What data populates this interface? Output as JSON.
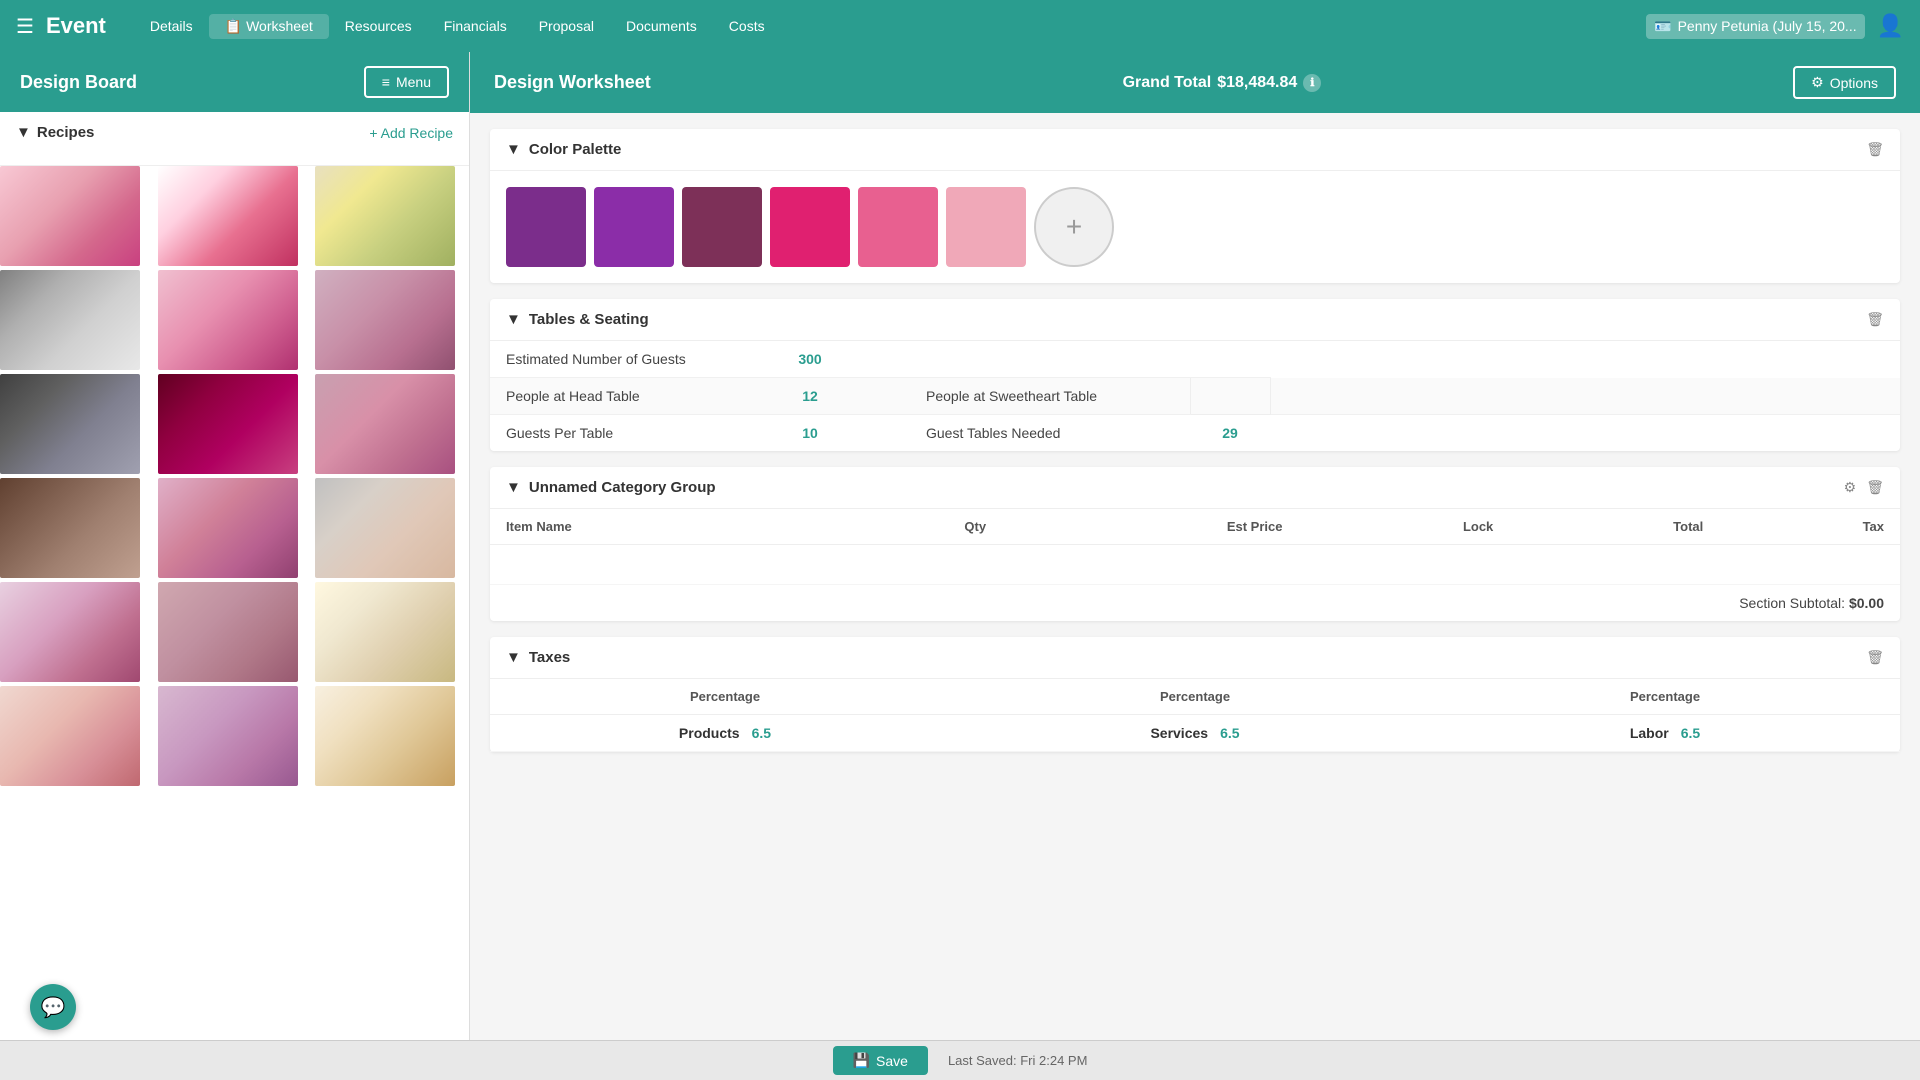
{
  "nav": {
    "brand": "Event",
    "links": [
      {
        "label": "Details",
        "active": false
      },
      {
        "label": "Worksheet",
        "active": true,
        "icon": "📋"
      },
      {
        "label": "Resources",
        "active": false
      },
      {
        "label": "Financials",
        "active": false
      },
      {
        "label": "Proposal",
        "active": false
      },
      {
        "label": "Documents",
        "active": false
      },
      {
        "label": "Costs",
        "active": false
      }
    ],
    "user": "Penny Petunia (July 15, 20...",
    "user_icon": "👤"
  },
  "left_panel": {
    "title": "Design Board",
    "menu_btn": "Menu",
    "recipes_label": "Recipes",
    "add_recipe_label": "+ Add Recipe",
    "images": [
      {
        "id": 1,
        "class": "img-1"
      },
      {
        "id": 2,
        "class": "img-2"
      },
      {
        "id": 3,
        "class": "img-3"
      },
      {
        "id": 4,
        "class": "img-4"
      },
      {
        "id": 5,
        "class": "img-5"
      },
      {
        "id": 6,
        "class": "img-6"
      },
      {
        "id": 7,
        "class": "img-7"
      },
      {
        "id": 8,
        "class": "img-8"
      },
      {
        "id": 9,
        "class": "img-9"
      },
      {
        "id": 10,
        "class": "img-10"
      },
      {
        "id": 11,
        "class": "img-11"
      },
      {
        "id": 12,
        "class": "img-12"
      },
      {
        "id": 13,
        "class": "img-13"
      },
      {
        "id": 14,
        "class": "img-14"
      },
      {
        "id": 15,
        "class": "img-15"
      },
      {
        "id": 16,
        "class": "img-16"
      },
      {
        "id": 17,
        "class": "img-17"
      },
      {
        "id": 18,
        "class": "img-18"
      }
    ]
  },
  "right_panel": {
    "title": "Design Worksheet",
    "grand_total_label": "Grand Total",
    "grand_total_value": "$18,484.84",
    "options_btn": "Options",
    "color_palette": {
      "section_title": "Color Palette",
      "colors": [
        "#7B2D8B",
        "#8B2D9B",
        "#7D3050",
        "#E02070",
        "#E86090",
        "#F0A8B8"
      ],
      "add_label": "+"
    },
    "tables_seating": {
      "section_title": "Tables & Seating",
      "rows": [
        {
          "label1": "Estimated Number of Guests",
          "value1": "300",
          "label2": "",
          "value2": ""
        },
        {
          "label1": "People at Head Table",
          "value1": "12",
          "label2": "People at Sweetheart Table",
          "value2": ""
        },
        {
          "label1": "Guests Per Table",
          "value1": "10",
          "label2": "Guest Tables Needed",
          "value2": "29"
        }
      ]
    },
    "unnamed_category": {
      "section_title": "Unnamed Category Group",
      "columns": [
        "Item Name",
        "Qty",
        "Est Price",
        "Lock",
        "Total",
        "Tax"
      ],
      "items": [],
      "subtotal_label": "Section Subtotal:",
      "subtotal_value": "$0.00"
    },
    "taxes": {
      "section_title": "Taxes",
      "columns": [
        "Percentage",
        "Percentage",
        "Percentage"
      ],
      "rows": [
        {
          "col1_label": "Products",
          "col1_value": "6.5",
          "col2_label": "Services",
          "col2_value": "6.5",
          "col3_label": "Labor",
          "col3_value": "6.5"
        }
      ]
    }
  },
  "bottom_bar": {
    "save_btn": "Save",
    "last_saved": "Last Saved: Fri 2:24 PM"
  }
}
